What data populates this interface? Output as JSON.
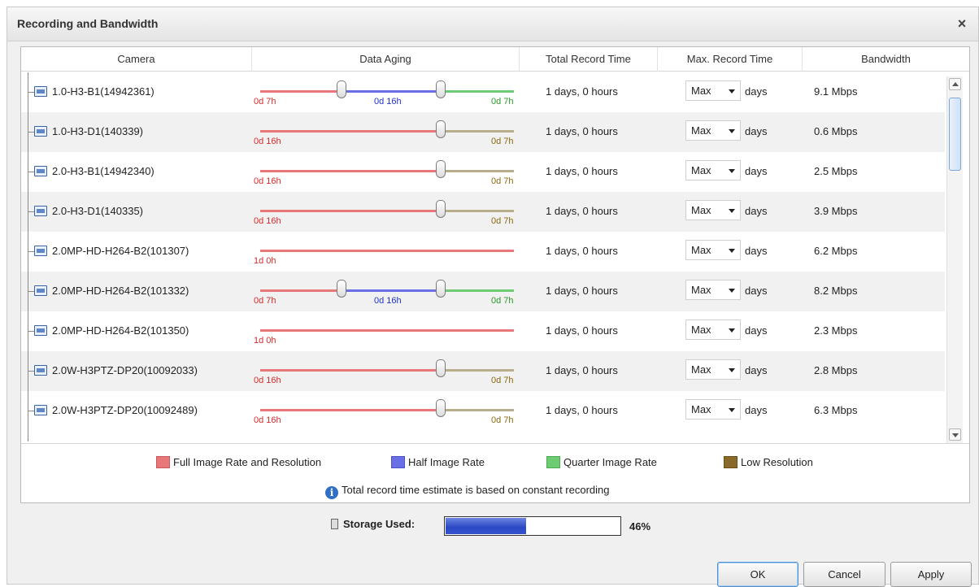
{
  "dialog": {
    "title": "Recording and Bandwidth",
    "close_label": "×"
  },
  "table": {
    "headers": [
      "Camera",
      "Data Aging",
      "Total Record Time",
      "Max. Record Time",
      "Bandwidth"
    ],
    "rows": [
      {
        "camera": "1.0-H3-B1(14942361)",
        "aging": "three",
        "labels": [
          "0d 7h",
          "0d 16h",
          "0d 7h"
        ],
        "total": "1 days, 0 hours",
        "max": "Max",
        "unit": "days",
        "bandwidth": "9.1 Mbps"
      },
      {
        "camera": "1.0-H3-D1(140339)",
        "aging": "two",
        "labels": [
          "0d 16h",
          "0d 7h"
        ],
        "total": "1 days, 0 hours",
        "max": "Max",
        "unit": "days",
        "bandwidth": "0.6 Mbps"
      },
      {
        "camera": "2.0-H3-B1(14942340)",
        "aging": "two",
        "labels": [
          "0d 16h",
          "0d 7h"
        ],
        "total": "1 days, 0 hours",
        "max": "Max",
        "unit": "days",
        "bandwidth": "2.5 Mbps"
      },
      {
        "camera": "2.0-H3-D1(140335)",
        "aging": "two",
        "labels": [
          "0d 16h",
          "0d 7h"
        ],
        "total": "1 days, 0 hours",
        "max": "Max",
        "unit": "days",
        "bandwidth": "3.9 Mbps"
      },
      {
        "camera": "2.0MP-HD-H264-B2(101307)",
        "aging": "one",
        "labels": [
          "1d 0h"
        ],
        "total": "1 days, 0 hours",
        "max": "Max",
        "unit": "days",
        "bandwidth": "6.2 Mbps"
      },
      {
        "camera": "2.0MP-HD-H264-B2(101332)",
        "aging": "three",
        "labels": [
          "0d 7h",
          "0d 16h",
          "0d 7h"
        ],
        "total": "1 days, 0 hours",
        "max": "Max",
        "unit": "days",
        "bandwidth": "8.2 Mbps"
      },
      {
        "camera": "2.0MP-HD-H264-B2(101350)",
        "aging": "one",
        "labels": [
          "1d 0h"
        ],
        "total": "1 days, 0 hours",
        "max": "Max",
        "unit": "days",
        "bandwidth": "2.3 Mbps"
      },
      {
        "camera": "2.0W-H3PTZ-DP20(10092033)",
        "aging": "two",
        "labels": [
          "0d 16h",
          "0d 7h"
        ],
        "total": "1 days, 0 hours",
        "max": "Max",
        "unit": "days",
        "bandwidth": "2.8 Mbps"
      },
      {
        "camera": "2.0W-H3PTZ-DP20(10092489)",
        "aging": "two",
        "labels": [
          "0d 16h",
          "0d 7h"
        ],
        "total": "1 days, 0 hours",
        "max": "Max",
        "unit": "days",
        "bandwidth": "6.3 Mbps"
      }
    ]
  },
  "legend": {
    "items": [
      {
        "label": "Full Image Rate and Resolution",
        "color": "#e8777a"
      },
      {
        "label": "Half Image Rate",
        "color": "#6b6fe6"
      },
      {
        "label": "Quarter Image Rate",
        "color": "#6dcc72"
      },
      {
        "label": "Low Resolution",
        "color": "#8a6a2a"
      }
    ],
    "note": "Total record time estimate is based on constant recording"
  },
  "storage": {
    "label": "Storage Used:",
    "percent": 46,
    "percent_text": "46%"
  },
  "buttons": {
    "ok": "OK",
    "cancel": "Cancel",
    "apply": "Apply"
  },
  "colors": {
    "full": "#e8777a",
    "half": "#6b6fe6",
    "quarter": "#6dcc72",
    "low": "#b8ae8c",
    "label_full": "#d62b2b",
    "label_half": "#2233cc",
    "label_quarter": "#2a9a2a",
    "label_low": "#8a6a10"
  }
}
